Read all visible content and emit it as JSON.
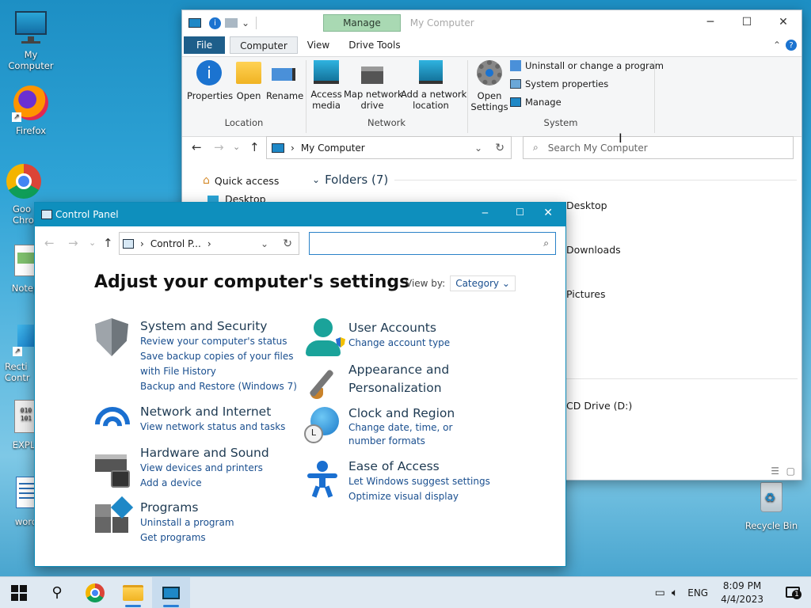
{
  "desktop": {
    "icons": [
      {
        "name": "my-computer",
        "label": "My Computer"
      },
      {
        "name": "firefox",
        "label": "Firefox"
      },
      {
        "name": "google-chrome",
        "label": "Goo\nChro"
      },
      {
        "name": "notepad",
        "label": "Notep"
      },
      {
        "name": "recti",
        "label": "Recti\nContr"
      },
      {
        "name": "explorer",
        "label": "EXPLC"
      },
      {
        "name": "wordpad",
        "label": "word"
      },
      {
        "name": "recycle-bin",
        "label": "Recycle Bin"
      }
    ]
  },
  "explorer": {
    "title": "My Computer",
    "manage_tab": "Manage",
    "tabs": [
      "File",
      "Computer",
      "View",
      "Drive Tools"
    ],
    "ribbon": {
      "properties": "Properties",
      "open": "Open",
      "rename": "Rename",
      "access_media": "Access\nmedia",
      "map_drive": "Map network\ndrive",
      "add_location": "Add a network\nlocation",
      "open_settings": "Open\nSettings",
      "uninstall": "Uninstall or change a program",
      "system_properties": "System properties",
      "manage": "Manage",
      "groups": [
        "Location",
        "Network",
        "System"
      ]
    },
    "address": "My Computer",
    "search_placeholder": "Search My Computer",
    "quick_access": "Quick access",
    "desktop_item": "Desktop",
    "folders_header": "Folders (7)",
    "folders": [
      "Desktop",
      "Downloads",
      "Pictures"
    ],
    "drive": "CD Drive (D:)"
  },
  "cpanel": {
    "title": "Control Panel",
    "address": "Control P...",
    "heading": "Adjust your computer's settings",
    "viewby_label": "View by:",
    "viewby_value": "Category",
    "categories": [
      {
        "title": "System and Security",
        "links": [
          "Review your computer's status",
          "Save backup copies of your files with File History",
          "Backup and Restore (Windows 7)"
        ]
      },
      {
        "title": "Network and Internet",
        "links": [
          "View network status and tasks"
        ]
      },
      {
        "title": "Hardware and Sound",
        "links": [
          "View devices and printers",
          "Add a device"
        ]
      },
      {
        "title": "Programs",
        "links": [
          "Uninstall a program",
          "Get programs"
        ]
      },
      {
        "title": "User Accounts",
        "links": [
          "Change account type"
        ]
      },
      {
        "title": "Appearance and Personalization",
        "links": []
      },
      {
        "title": "Clock and Region",
        "links": [
          "Change date, time, or number formats"
        ]
      },
      {
        "title": "Ease of Access",
        "links": [
          "Let Windows suggest settings",
          "Optimize visual display"
        ]
      }
    ]
  },
  "taskbar": {
    "lang": "ENG",
    "time": "8:09 PM",
    "date": "4/4/2023",
    "notif_count": "1"
  },
  "colors": {
    "accent": "#0e8fbd",
    "link": "#1a4f8f",
    "manage_tab": "#a9d9b3"
  }
}
